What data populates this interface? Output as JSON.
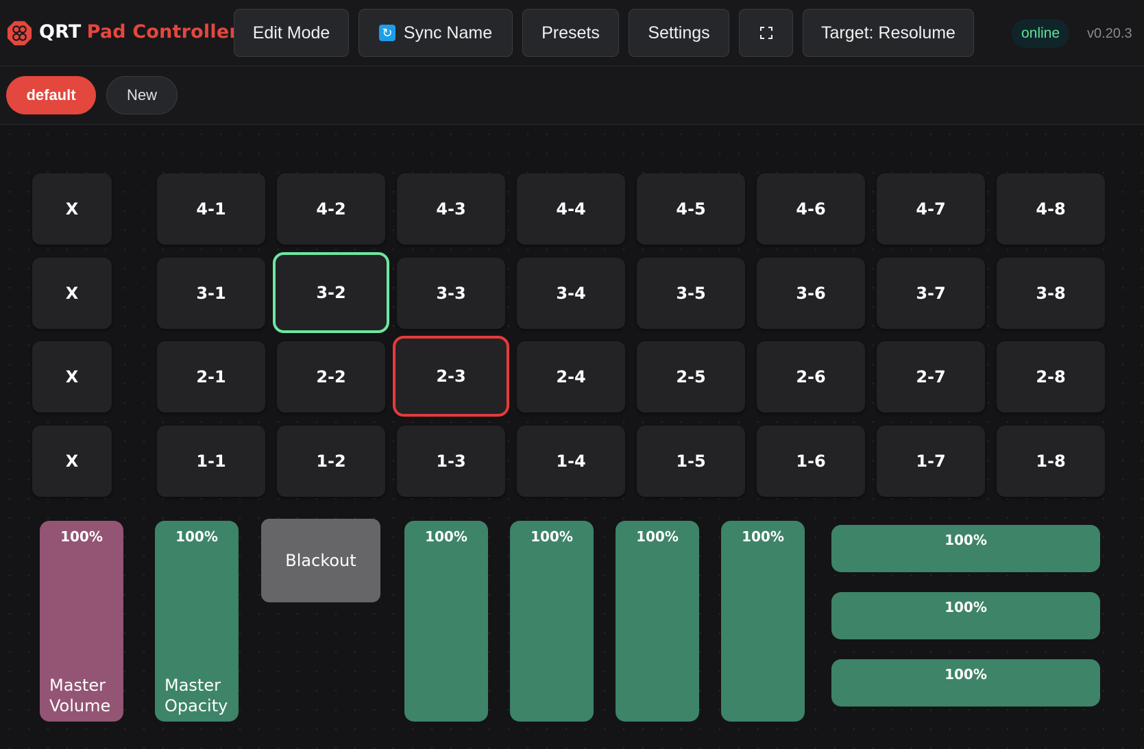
{
  "app": {
    "brand": "QRT",
    "subtitle": "Pad Controller",
    "status": "online",
    "version": "v0.20.3"
  },
  "toolbar": {
    "edit_mode": "Edit Mode",
    "sync_name": "Sync Name",
    "presets": "Presets",
    "settings": "Settings",
    "fullscreen_icon": "fullscreen-icon",
    "target": "Target: Resolume"
  },
  "tabs": [
    {
      "label": "default",
      "active": true
    },
    {
      "label": "New",
      "active": false
    }
  ],
  "pads": {
    "clear_label": "X",
    "rows": [
      [
        "4-1",
        "4-2",
        "4-3",
        "4-4",
        "4-5",
        "4-6",
        "4-7",
        "4-8"
      ],
      [
        "3-1",
        "3-2",
        "3-3",
        "3-4",
        "3-5",
        "3-6",
        "3-7",
        "3-8"
      ],
      [
        "2-1",
        "2-2",
        "2-3",
        "2-4",
        "2-5",
        "2-6",
        "2-7",
        "2-8"
      ],
      [
        "1-1",
        "1-2",
        "1-3",
        "1-4",
        "1-5",
        "1-6",
        "1-7",
        "1-8"
      ]
    ],
    "selected_green": "3-2",
    "selected_red": "2-3"
  },
  "faders": {
    "master_volume": {
      "value": "100%",
      "label_line1": "Master",
      "label_line2": "Volume"
    },
    "master_opacity": {
      "value": "100%",
      "label_line1": "Master",
      "label_line2": "Opacity"
    },
    "blackout_label": "Blackout",
    "layers": [
      "100%",
      "100%",
      "100%",
      "100%"
    ],
    "horizontal": [
      "100%",
      "100%",
      "100%"
    ]
  },
  "colors": {
    "accent": "#e4473d",
    "fader_green": "#3e8468",
    "fader_pink": "#935573",
    "select_green": "#6ce8a1",
    "select_red": "#e63b3b",
    "status_green": "#5ee39a"
  }
}
